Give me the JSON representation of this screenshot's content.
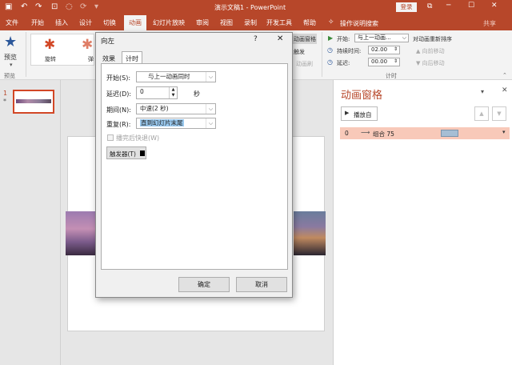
{
  "titlebar": {
    "title": "演示文稿1 - PowerPoint",
    "login": "登录",
    "minimize": "─",
    "maximize": "☐",
    "close": "✕",
    "restore": "⧉"
  },
  "tabs": [
    "文件",
    "开始",
    "插入",
    "设计",
    "切换",
    "动画",
    "幻灯片放映",
    "审阅",
    "视图",
    "录制",
    "开发工具",
    "帮助"
  ],
  "tell_me": "操作说明搜索",
  "share": "共享",
  "ribbon": {
    "preview": "预览",
    "preview_group": "预览",
    "effect1": "旋转",
    "effect2": "弹",
    "anim_pane_btn": "动画窗格",
    "trigger_btn": "触发",
    "painter_btn": "动画刷",
    "start_label": "开始:",
    "start_value": "与上一动画...",
    "duration_label": "持续时间:",
    "duration_value": "02.00",
    "delay_label": "延迟:",
    "delay_value": "00.00",
    "timing_group": "计时",
    "reorder_title": "对动画重新排序",
    "move_earlier": "向前移动",
    "move_later": "向后移动"
  },
  "thumb": {
    "number": "1",
    "star": "*"
  },
  "animpane": {
    "title": "动画窗格",
    "play_from": "播放自",
    "item_index": "0",
    "item_name": "组合 75"
  },
  "dialog": {
    "title": "向左",
    "help": "?",
    "close": "✕",
    "tab_effect": "效果",
    "tab_timing": "计时",
    "start_label": "开始(S):",
    "start_value": "与上一动画同时",
    "delay_label": "延迟(D):",
    "delay_value": "0",
    "delay_unit": "秒",
    "period_label": "期间(N):",
    "period_value": "中速(2 秒)",
    "repeat_label": "重复(R):",
    "repeat_value": "直到幻灯片末尾",
    "rewind_label": "播完后快退(W)",
    "trigger_label": "触发器(T)",
    "ok": "确定",
    "cancel": "取消"
  }
}
